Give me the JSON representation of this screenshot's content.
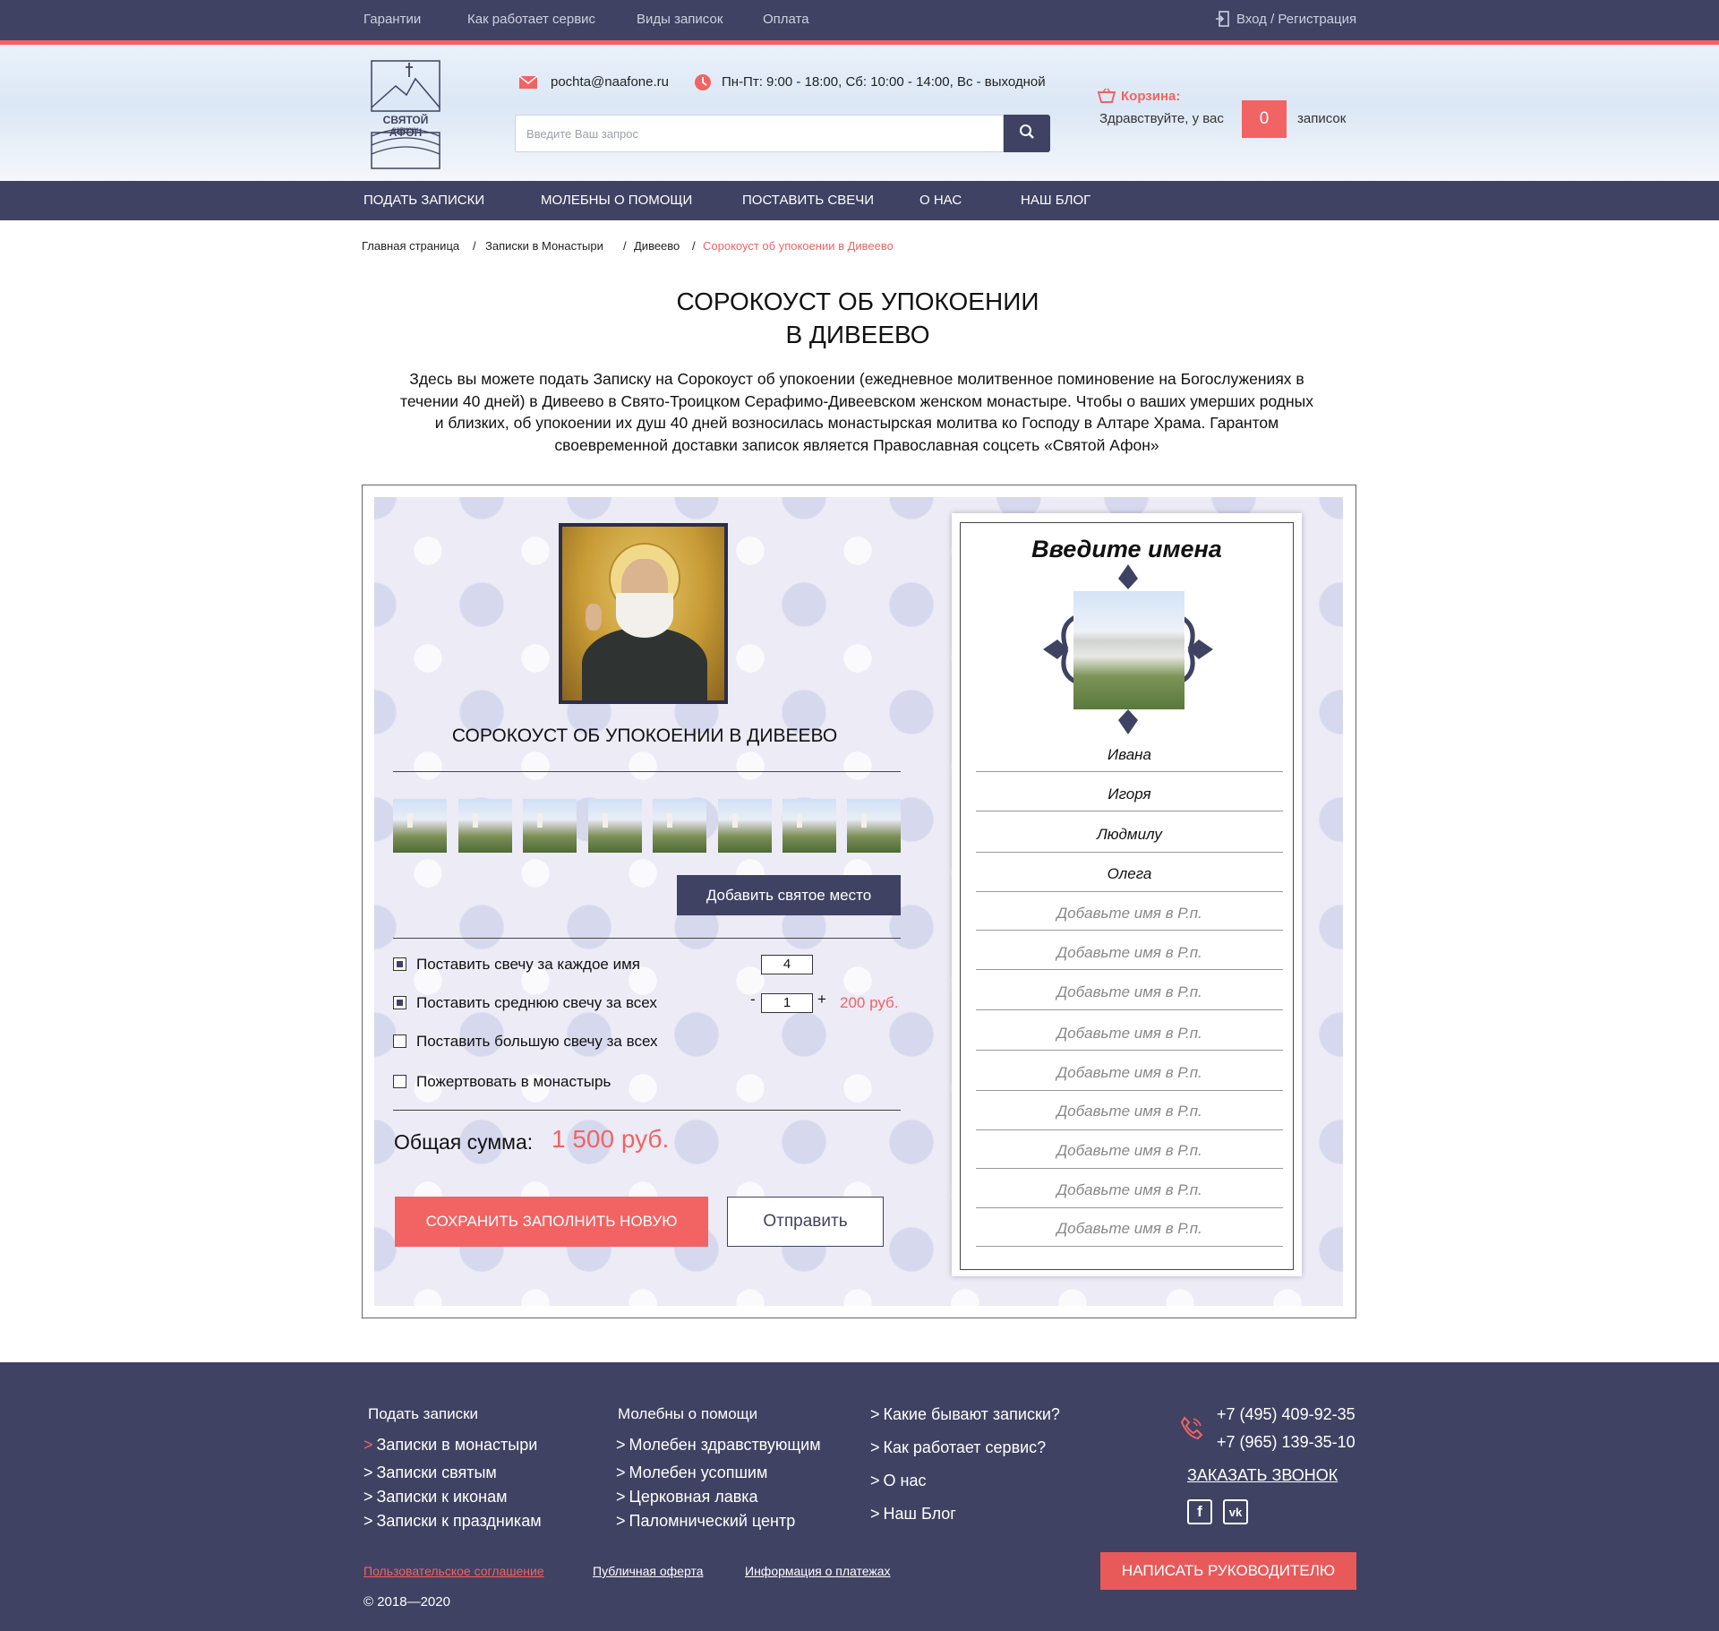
{
  "topbar": {
    "links": [
      "Гарантии",
      "Как работает сервис",
      "Виды записок",
      "Оплата"
    ],
    "login": "Вход / Регистрация"
  },
  "header": {
    "logo_text": "СВЯТОЙ АФОН",
    "logo_sub": "записки",
    "email": "pochta@naafone.ru",
    "hours": "Пн-Пт: 9:00 - 18:00, Сб: 10:00 - 14:00, Вс - выходной",
    "search_placeholder": "Введите Ваш запрос",
    "cart_label": "Корзина:",
    "cart_text": "Здравствуйте, у вас",
    "cart_count": "0",
    "cart_suffix": "записок"
  },
  "nav": [
    "ПОДАТЬ ЗАПИСКИ",
    "МОЛЕБНЫ О ПОМОЩИ",
    "ПОСТАВИТЬ СВЕЧИ",
    "О НАС",
    "НАШ БЛОГ"
  ],
  "breadcrumb": [
    "Главная страница",
    "Записки в Монастыри",
    "Дивеево",
    "Сорокоуст об упокоении в Дивеево"
  ],
  "page": {
    "title_line1": "СОРОКОУСТ ОБ УПОКОЕНИИ",
    "title_line2": "В ДИВЕЕВО",
    "intro": "Здесь вы можете подать Записку на Сорокоуст об упокоении (ежедневное молитвенное поминовение на Богослужениях в течении 40 дней) в Дивеево в Свято-Троицком Серафимо-Дивеевском женском монастыре. Чтобы о ваших умерших родных и близких, об упокоении их душ 40 дней возносилась монастырская молитва ко Господу в Алтаре Храма. Гарантом своевременной доставки записок является Православная соцсеть «Святой Афон»"
  },
  "form": {
    "title": "СОРОКОУСТ ОБ УПОКОЕНИИ В ДИВЕЕВО",
    "add_place": "Добавить святое место",
    "options": [
      {
        "label": "Поставить свечу за каждое имя",
        "checked": true,
        "qty": "4"
      },
      {
        "label": "Поставить среднюю свечу за всех",
        "checked": true,
        "qty": "1",
        "price": "200 руб."
      },
      {
        "label": "Поставить большую свечу за всех",
        "checked": false
      },
      {
        "label": "Пожертвовать в монастырь",
        "checked": false
      }
    ],
    "minus": "-",
    "plus": "+",
    "total_label": "Общая сумма:",
    "total_value": "1 500 руб.",
    "save_button": "СОХРАНИТЬ ЗАПОЛНИТЬ НОВУЮ",
    "send_button": "Отправить"
  },
  "names": {
    "title": "Введите имена",
    "filled": [
      "Ивана",
      "Игоря",
      "Людмилу",
      "Олега"
    ],
    "placeholder": "Добавьте имя в Р.п."
  },
  "footer": {
    "col1_title": "Подать записки",
    "col1": [
      "Записки в монастыри",
      "Записки святым",
      "Записки к иконам",
      "Записки к праздникам"
    ],
    "col2_title": "Молебны о помощи",
    "col2": [
      "Молебен здравствующим",
      "Молебен усопшим",
      "Церковная лавка",
      "Паломнический центр"
    ],
    "col3": [
      "Какие бывают записки?",
      "Как работает сервис?",
      "О нас",
      "Наш Блог"
    ],
    "phones": [
      "+7 (495) 409-92-35",
      "+7 (965) 139-35-10"
    ],
    "callback": "ЗАКАЗАТЬ ЗВОНОК",
    "write_button": "НАПИСАТЬ РУКОВОДИТЕЛЮ",
    "links": [
      "Пользовательское соглашение",
      "Публичная оферта",
      "Информация о платежах"
    ],
    "copyright": "© 2018—2020"
  },
  "colors": {
    "accent": "#f26363",
    "navy": "#3f4262"
  }
}
